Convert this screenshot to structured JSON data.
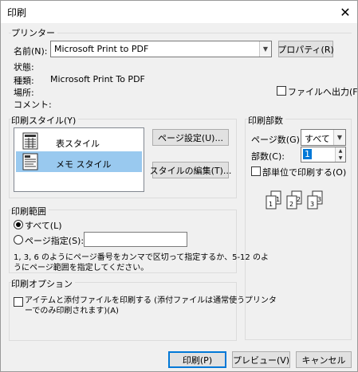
{
  "window": {
    "title": "印刷",
    "close_glyph": "✕"
  },
  "printer": {
    "group_label": "プリンター",
    "name_label": "名前(N):",
    "name_value": "Microsoft Print to PDF",
    "properties_button": "プロパティ(R)",
    "status_label": "状態:",
    "type_label": "種類:",
    "type_value": "Microsoft Print To PDF",
    "location_label": "場所:",
    "comment_label": "コメント:",
    "print_to_file_label": "ファイルへ出力(F)"
  },
  "print_style": {
    "group_label": "印刷スタイル(Y)",
    "items": [
      {
        "label": "表スタイル",
        "selected": false,
        "icon": "table-style-icon"
      },
      {
        "label": "メモ スタイル",
        "selected": true,
        "icon": "memo-style-icon"
      }
    ],
    "page_setup_button": "ページ設定(U)...",
    "edit_styles_button": "スタイルの編集(T)..."
  },
  "copies": {
    "group_label": "印刷部数",
    "pages_label": "ページ数(G):",
    "pages_value": "すべて",
    "count_label": "部数(C):",
    "count_value": "1",
    "collate_label": "部単位で印刷する(O)",
    "collate_pages": [
      "1",
      "1",
      "2",
      "2",
      "3",
      "3"
    ]
  },
  "print_range": {
    "group_label": "印刷範囲",
    "all_label": "すべて(L)",
    "pages_label": "ページ指定(S):",
    "pages_value": "",
    "hint": "1, 3, 6 のようにページ番号をカンマで区切って指定するか、5-12 のよ",
    "hint2": "うにページ範囲を指定してください。"
  },
  "print_options": {
    "group_label": "印刷オプション",
    "attachments_label": "アイテムと添付ファイルを印刷する (添付ファイルは通常使うプリンタ",
    "attachments_label2": "ーでのみ印刷されます)(A)"
  },
  "footer": {
    "print_button": "印刷(P)",
    "preview_button": "プレビュー(V)",
    "cancel_button": "キャンセル"
  }
}
